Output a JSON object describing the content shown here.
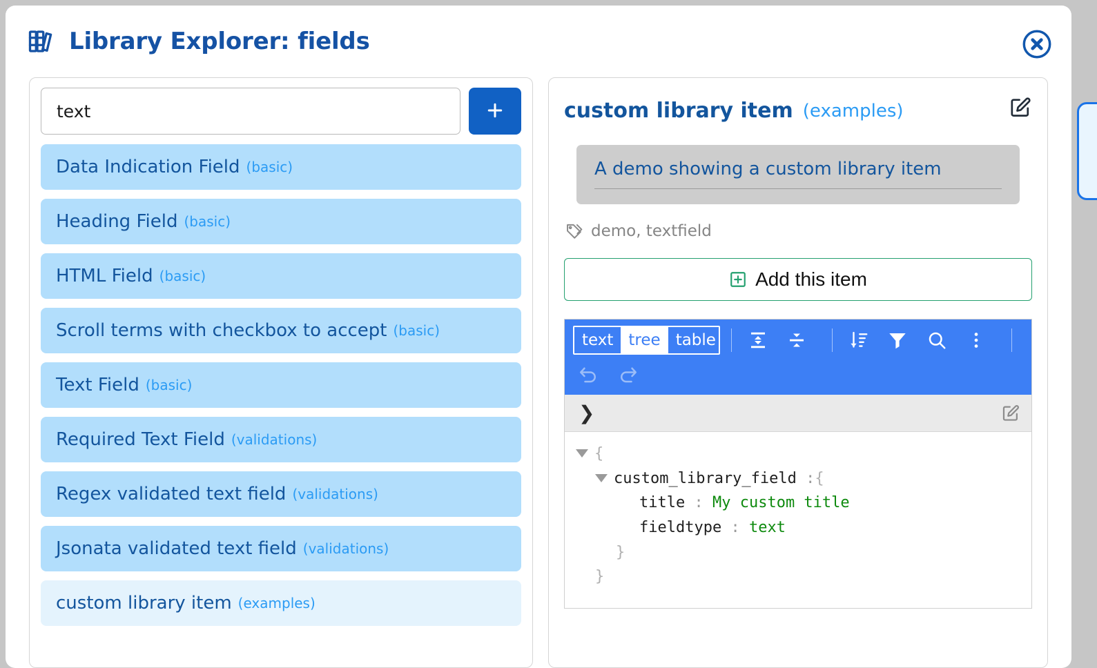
{
  "window": {
    "title": "Library Explorer: fields",
    "books_icon": "books-icon",
    "close_icon": "close-circle-icon",
    "accent_color": "#1552a4",
    "background_color": "#c6c6c6"
  },
  "search": {
    "value": "text",
    "placeholder": "",
    "add_button_icon": "plus-icon"
  },
  "results": [
    {
      "name": "Data Indication Field",
      "category": "(basic)",
      "selected": false
    },
    {
      "name": "Heading Field",
      "category": "(basic)",
      "selected": false
    },
    {
      "name": "HTML Field",
      "category": "(basic)",
      "selected": false
    },
    {
      "name": "Scroll terms with checkbox to accept",
      "category": "(basic)",
      "selected": false
    },
    {
      "name": "Text Field",
      "category": "(basic)",
      "selected": false
    },
    {
      "name": "Required Text Field",
      "category": "(validations)",
      "selected": false
    },
    {
      "name": "Regex validated text field",
      "category": "(validations)",
      "selected": false
    },
    {
      "name": "Jsonata validated text field",
      "category": "(validations)",
      "selected": false
    },
    {
      "name": "custom library item",
      "category": "(examples)",
      "selected": true
    }
  ],
  "detail": {
    "title": "custom library item",
    "category": "(examples)",
    "edit_icon": "edit-square-icon",
    "description": "A demo showing a custom library item",
    "tags_icon": "tag-icon",
    "tags": "demo, textfield",
    "add_item_label": "Add this item",
    "add_item_icon": "plus-square-icon",
    "item_bg_color": "#b2defc",
    "selected_bg_color": "#e4f3fd"
  },
  "json_editor": {
    "toolbar_color": "#3d7ff5",
    "modes": [
      {
        "label": "text",
        "active": false
      },
      {
        "label": "tree",
        "active": true
      },
      {
        "label": "table",
        "active": false
      }
    ],
    "icons": [
      "expand-all-icon",
      "collapse-all-icon",
      "sort-icon",
      "filter-icon",
      "search-icon",
      "more-vertical-icon"
    ],
    "history_icons": [
      "undo-icon",
      "redo-icon"
    ],
    "path_chevron": "❯",
    "path_edit_icon": "edit-square-icon",
    "tree": {
      "open_brace": "{",
      "root_key": "custom_library_field",
      "root_colon": ":",
      "root_brace": "{",
      "entries": [
        {
          "key": "title",
          "colon": ":",
          "value": "My custom title"
        },
        {
          "key": "fieldtype",
          "colon": ":",
          "value": "text"
        }
      ],
      "close_inner": "}",
      "close_outer": "}"
    }
  }
}
